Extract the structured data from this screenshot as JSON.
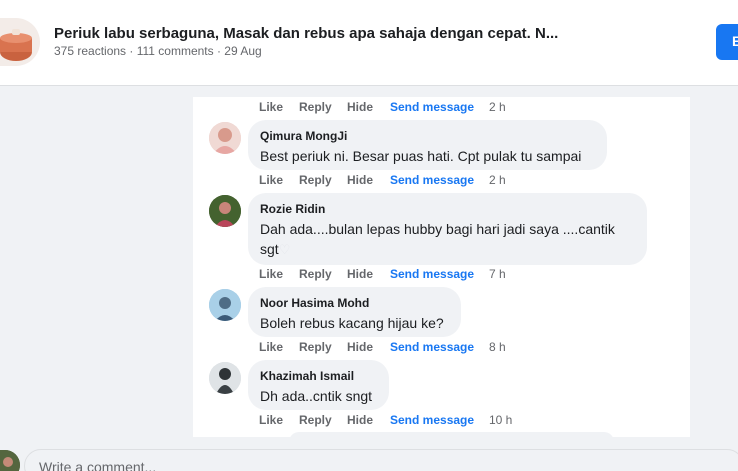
{
  "header": {
    "title": "Periuk labu serbaguna, Masak dan rebus apa sahaja dengan cepat. N...",
    "meta": "375 reactions · 111 comments · 29 Aug",
    "button_label": "E"
  },
  "labels": {
    "like": "Like",
    "reply": "Reply",
    "hide": "Hide",
    "send_message": "Send message"
  },
  "top_actions": {
    "time": "2 h"
  },
  "comments": [
    {
      "author": "Qimura MongJi",
      "text": "Best periuk ni. Besar puas hati. Cpt pulak tu sampai",
      "time": "2 h"
    },
    {
      "author": "Rozie Ridin",
      "text": "Dah ada....bulan lepas hubby bagi hari jadi saya ....cantik sgt",
      "time": "7 h"
    },
    {
      "author": "Noor Hasima Mohd",
      "text": "Boleh rebus kacang hijau ke?",
      "time": "8 h"
    },
    {
      "author": "Khazimah Ismail",
      "text": "Dh ada..cntik sngt",
      "time": "10 h"
    }
  ],
  "composer": {
    "placeholder": "Write a comment..."
  },
  "icons": {
    "heart": "white-heart-emoji"
  }
}
